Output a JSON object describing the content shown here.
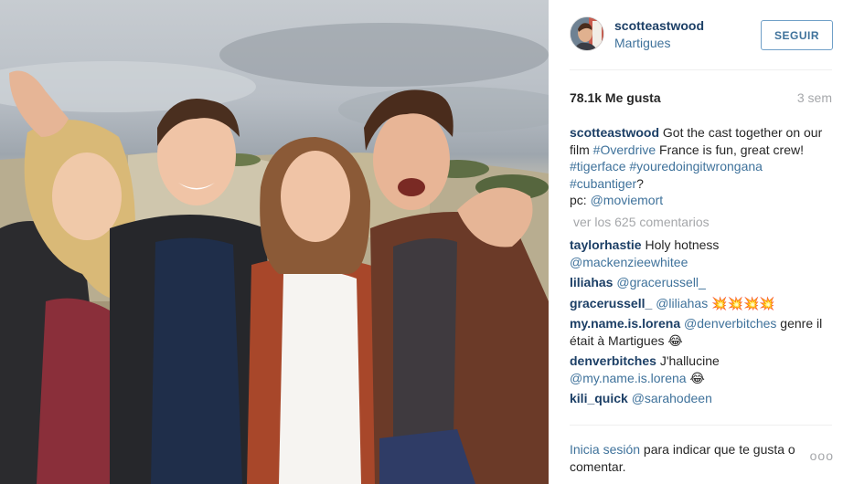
{
  "post": {
    "username": "scotteastwood",
    "location": "Martigues",
    "follow_label": "SEGUIR",
    "likes": "78.1k Me gusta",
    "time_ago": "3 sem",
    "caption": {
      "user": "scotteastwood",
      "t1": "Got the cast together on our film ",
      "h1": "#Overdrive",
      "t2": " France is fun, great crew! ",
      "h2": "#tigerface",
      "t3": " ",
      "h3": "#youredoingitwrongana",
      "t4": " ",
      "h4": "#cubantiger",
      "t5": "?",
      "t6": "pc: ",
      "m1": "@moviemort"
    },
    "view_comments": "ver los 625 comentarios",
    "comments": [
      {
        "user": "taylorhastie",
        "text": "Holy hotness ",
        "mention": "@mackenzieewhitee",
        "after": ""
      },
      {
        "user": "liliahas",
        "text": "",
        "mention": "@gracerussell_",
        "after": ""
      },
      {
        "user": "gracerussell_",
        "text": "",
        "mention": "@liliahas",
        "after": " 💥💥💥💥"
      },
      {
        "user": "my.name.is.lorena",
        "text": "",
        "mention": "@denverbitches",
        "after": " genre il était à Martigues 😂"
      },
      {
        "user": "denverbitches",
        "text": "J'hallucine ",
        "mention": "@my.name.is.lorena",
        "after": " 😂"
      },
      {
        "user": "kili_quick",
        "text": "",
        "mention": "@sarahodeen",
        "after": ""
      }
    ],
    "login_link": "Inicia sesión",
    "login_text": " para indicar que te gusta o comentar.",
    "options_label": "ooo"
  },
  "colors": {
    "username": "#1c3f66",
    "link": "#3f729b",
    "muted": "#a5a7aa",
    "text": "#262626"
  },
  "icons": {
    "avatar": "profile-avatar",
    "options": "more-options-icon"
  }
}
